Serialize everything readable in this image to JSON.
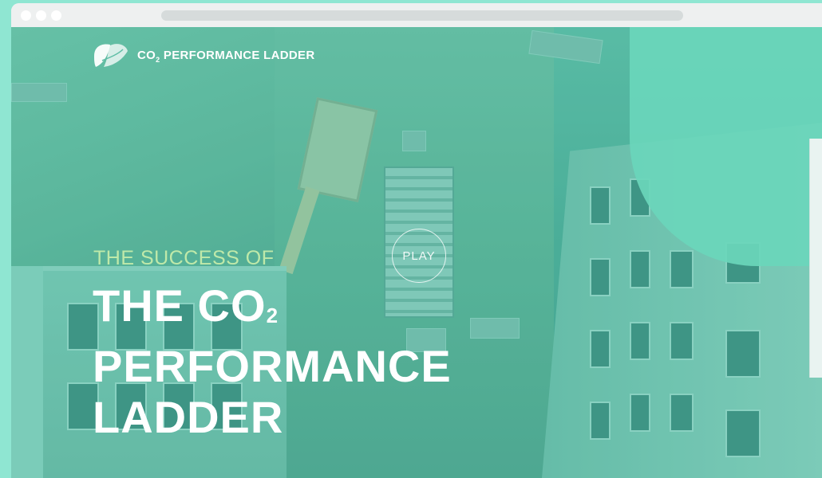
{
  "browser": {
    "window_dots": [
      "close",
      "minimize",
      "maximize"
    ]
  },
  "brand": {
    "name_prefix": "CO",
    "name_subscript": "2",
    "name_suffix": " PERFORMANCE LADDER",
    "logo_icon": "leaf-logo-icon"
  },
  "video": {
    "play_label": "PLAY",
    "play_icon": "play-circle-icon"
  },
  "hero": {
    "kicker": "THE SUCCESS OF",
    "line1_prefix": "THE CO",
    "line1_subscript": "2",
    "line2": "PERFORMANCE",
    "line3": "LADDER"
  },
  "colors": {
    "accent_teal": "#6ad6bb",
    "kicker_green": "#bfe9a9",
    "headline_white": "#ffffff",
    "frame_mint": "#8fe6d2"
  }
}
